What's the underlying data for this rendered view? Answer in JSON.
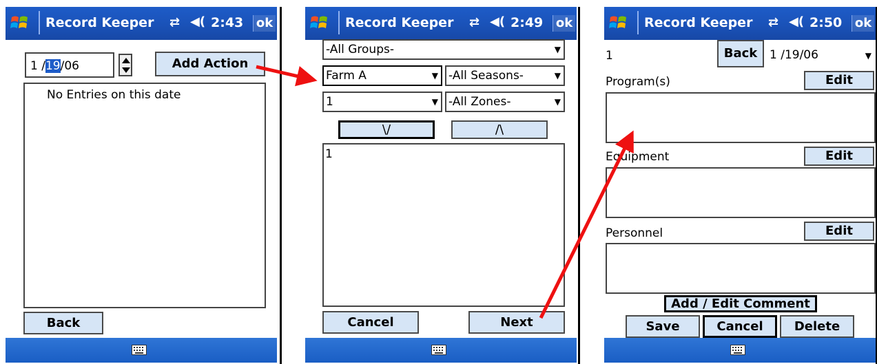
{
  "app_title": "Record Keeper",
  "ok_label": "ok",
  "screen1": {
    "time": "2:43",
    "date_prefix": "1 /",
    "date_selected": "19",
    "date_suffix": "/06",
    "add_action": "Add Action",
    "no_entries": "No Entries on this date",
    "back": "Back"
  },
  "screen2": {
    "time": "2:49",
    "groups": "-All Groups-",
    "farm": "Farm A",
    "seasons": "-All Seasons-",
    "field": "1",
    "zones": "-All Zones-",
    "down_btn": "\\/",
    "up_btn": "/\\",
    "list_item": "1",
    "cancel": "Cancel",
    "next": "Next"
  },
  "screen3": {
    "time": "2:50",
    "id": "1",
    "back": "Back",
    "date": "1 /19/06",
    "program_label": "Program(s)",
    "equipment_label": "Equipment",
    "personnel_label": "Personnel",
    "edit": "Edit",
    "add_comment": "Add / Edit Comment",
    "save": "Save",
    "cancel": "Cancel",
    "delete": "Delete"
  },
  "colors": {
    "titlebar": "#1a52b8",
    "button": "#d6e5f6",
    "arrow": "#ee1111",
    "selection": "#1e5cc8"
  }
}
